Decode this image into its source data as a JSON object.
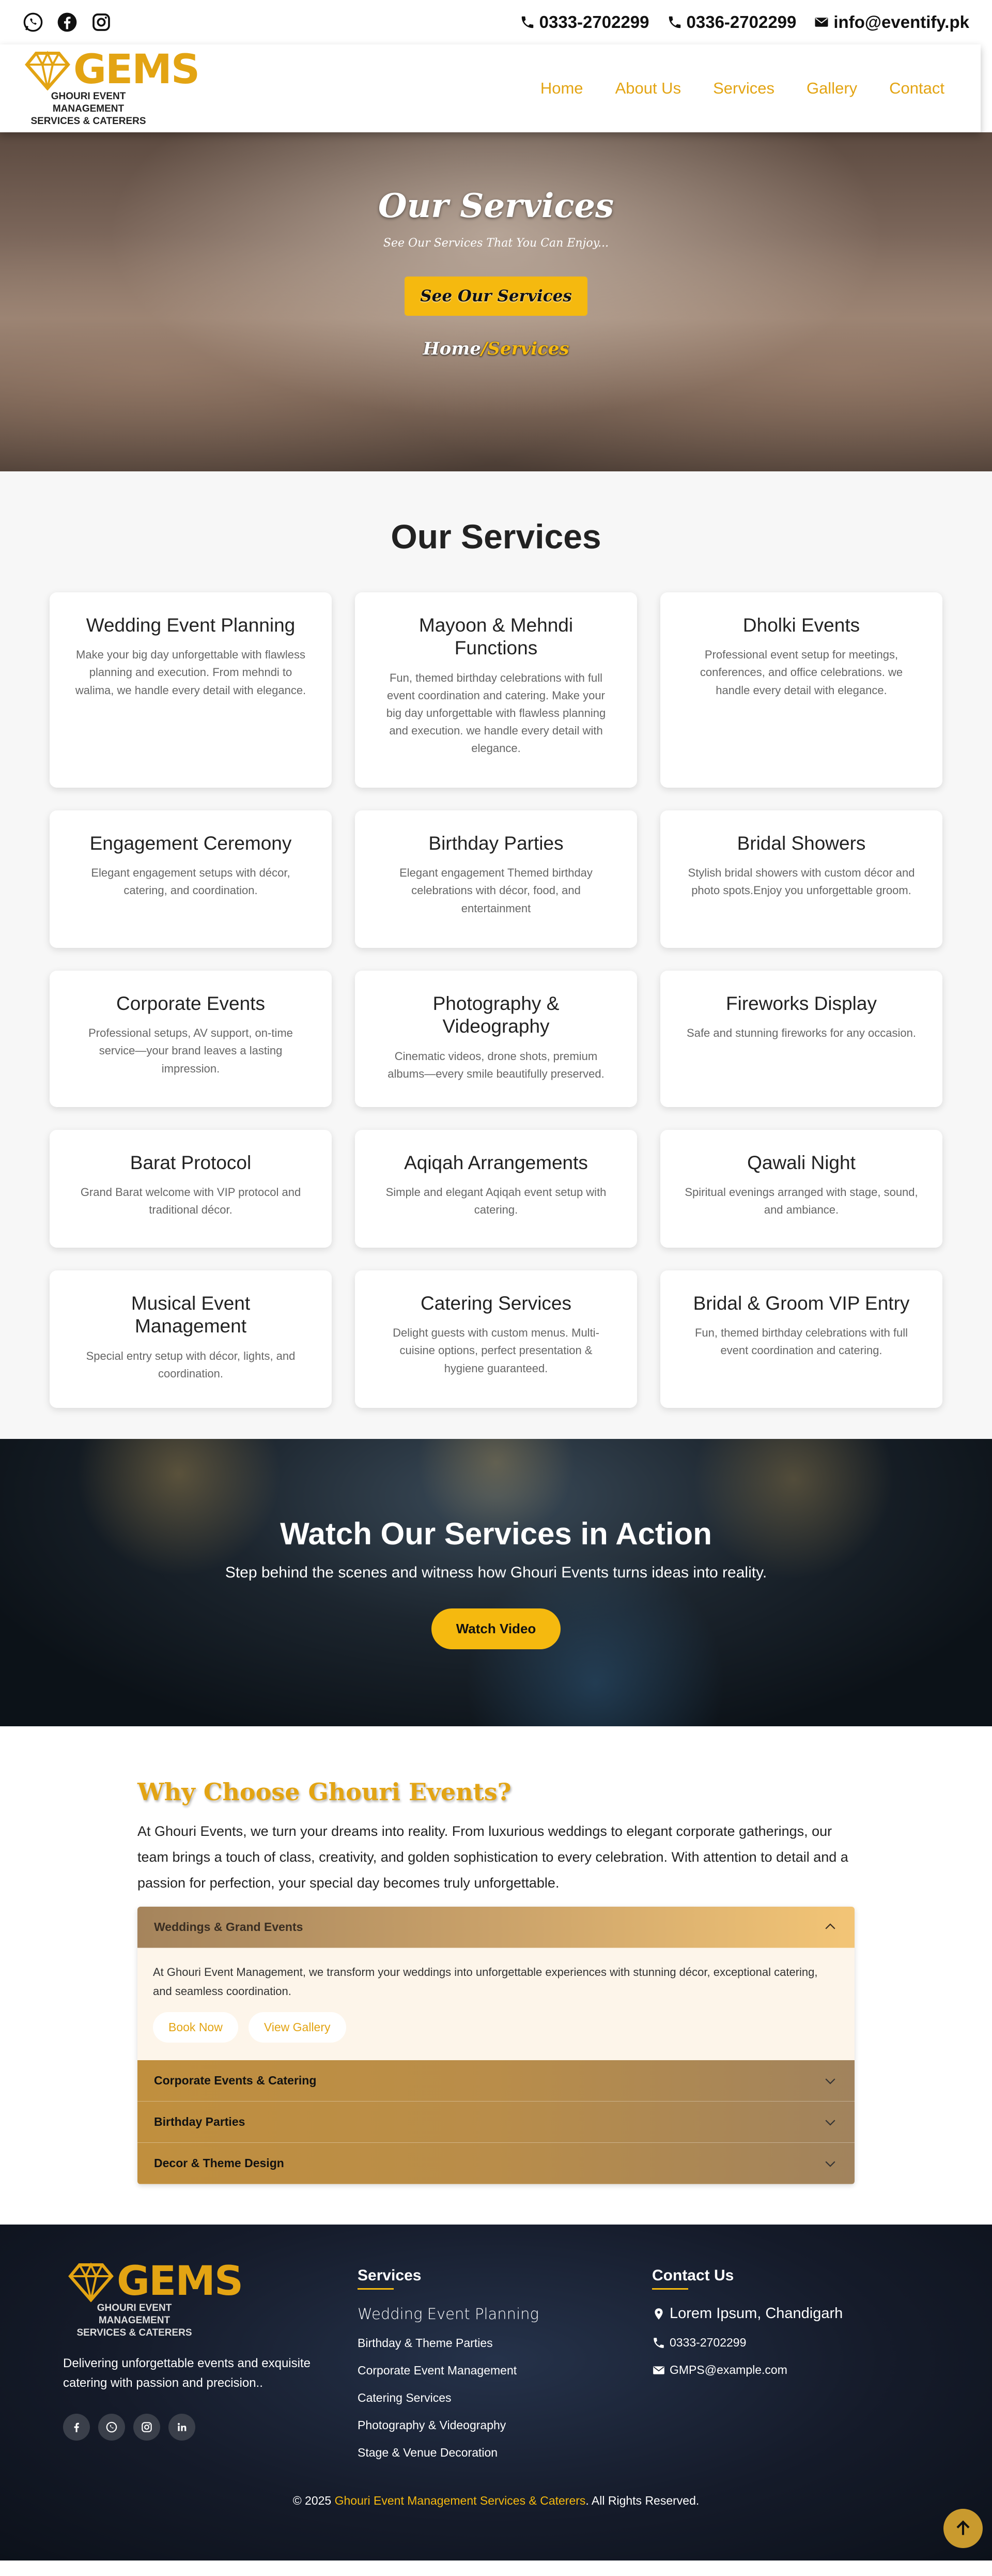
{
  "topbar": {
    "socials": [
      "whatsapp-icon",
      "facebook-icon",
      "instagram-icon"
    ],
    "phone1": "0333-2702299",
    "phone2": "0336-2702299",
    "email": "info@eventify.pk"
  },
  "header": {
    "logo_word": "GEMS",
    "logo_sub1": "GHOURI EVENT MANAGEMENT",
    "logo_sub2": "SERVICES & CATERERS",
    "nav": [
      "Home",
      "About Us",
      "Services",
      "Gallery",
      "Contact"
    ]
  },
  "hero": {
    "title": "Our Services",
    "subtitle": "See Our Services That You Can Enjoy...",
    "button": "See Our Services",
    "crumb_home": "Home",
    "crumb_sep": "/",
    "crumb_current": "Services"
  },
  "services": {
    "heading": "Our Services",
    "cards": [
      {
        "title": "Wedding Event Planning",
        "text": "Make your big day unforgettable with flawless planning and execution. From mehndi to walima, we handle every detail with elegance."
      },
      {
        "title": "Mayoon & Mehndi Functions",
        "text": "Fun, themed birthday celebrations with full event coordination and catering. Make your big day unforgettable with flawless planning and execution. we handle every detail with elegance."
      },
      {
        "title": "Dholki Events",
        "text": "Professional event setup for meetings, conferences, and office celebrations. we handle every detail with elegance."
      },
      {
        "title": "Engagement Ceremony",
        "text": "Elegant engagement setups with décor, catering, and coordination."
      },
      {
        "title": "Birthday Parties",
        "text": "Elegant engagement Themed birthday celebrations with décor, food, and entertainment"
      },
      {
        "title": "Bridal Showers",
        "text": "Stylish bridal showers with custom décor and photo spots.Enjoy you unforgettable groom."
      },
      {
        "title": "Corporate Events",
        "text": "Professional setups, AV support, on-time service—your brand leaves a lasting impression."
      },
      {
        "title": "Photography & Videography",
        "text": "Cinematic videos, drone shots, premium albums—every smile beautifully preserved."
      },
      {
        "title": "Fireworks Display",
        "text": "Safe and stunning fireworks for any occasion."
      },
      {
        "title": "Barat Protocol",
        "text": "Grand Barat welcome with VIP protocol and traditional décor."
      },
      {
        "title": "Aqiqah Arrangements",
        "text": "Simple and elegant Aqiqah event setup with catering."
      },
      {
        "title": "Qawali Night",
        "text": "Spiritual evenings arranged with stage, sound, and ambiance."
      },
      {
        "title": "Musical Event Management",
        "text": "Special entry setup with décor, lights, and coordination."
      },
      {
        "title": "Catering Services",
        "text": "Delight guests with custom menus. Multi-cuisine options, perfect presentation & hygiene guaranteed."
      },
      {
        "title": "Bridal & Groom VIP Entry",
        "text": "Fun, themed birthday celebrations with full event coordination and catering."
      }
    ]
  },
  "video": {
    "heading": "Watch Our Services in Action",
    "text": "Step behind the scenes and witness how Ghouri Events turns ideas into reality.",
    "button": "Watch Video"
  },
  "why": {
    "heading": "Why Choose Ghouri Events?",
    "intro": "At Ghouri Events, we turn your dreams into reality. From luxurious weddings to elegant corporate gatherings, our team brings a touch of class, creativity, and golden sophistication to every celebration. With attention to detail and a passion for perfection, your special day becomes truly unforgettable.",
    "accordion": [
      {
        "title": "Weddings & Grand Events",
        "open": true
      },
      {
        "title": "Corporate Events & Catering",
        "open": false
      },
      {
        "title": "Birthday Parties",
        "open": false
      },
      {
        "title": "Decor & Theme Design",
        "open": false
      }
    ],
    "open_text": "At Ghouri Event Management, we transform your weddings into unforgettable experiences with stunning décor, exceptional catering, and seamless coordination.",
    "book_now": "Book Now",
    "view_gallery": "View Gallery"
  },
  "footer": {
    "logo_word": "GEMS",
    "logo_sub1": "GHOURI EVENT MANAGEMENT",
    "logo_sub2": "SERVICES & CATERERS",
    "description": "Delivering unforgettable events and exquisite catering with passion and precision..",
    "socials": [
      "facebook-icon",
      "whatsapp-icon",
      "instagram-icon",
      "linkedin-icon"
    ],
    "services_heading": "Services",
    "services": [
      "Wedding Event Planning",
      "Birthday & Theme Parties",
      "Corporate Event Management",
      "Catering Services",
      "Photography & Videography",
      "Stage & Venue Decoration"
    ],
    "contact_heading": "Contact Us",
    "address": "Lorem Ipsum, Chandigarh",
    "phone": "0333-2702299",
    "email": "GMPS@example.com",
    "copy_pre": "© 2025 ",
    "copy_brand": "Ghouri Event Management Services & Caterers",
    "copy_post": ". All Rights Reserved."
  },
  "colors": {
    "accent": "#f5b90f",
    "gold_text": "#e3a413",
    "footer_bg": "#151b2a"
  }
}
